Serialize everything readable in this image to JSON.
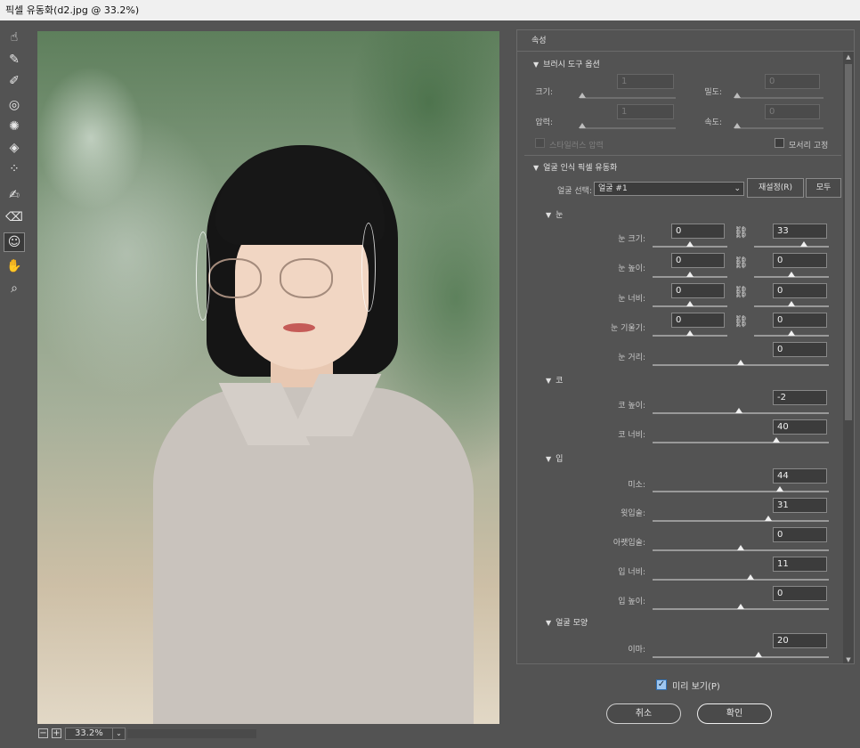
{
  "window": {
    "title": "픽셀 유동화(d2.jpg @ 33.2%)"
  },
  "toolbar": {
    "tools": [
      {
        "name": "forward-warp-tool",
        "glyph": "☝"
      },
      {
        "name": "reconstruct-tool",
        "glyph": "✎"
      },
      {
        "name": "smooth-tool",
        "glyph": "✐"
      },
      {
        "name": "twirl-tool",
        "glyph": "◎"
      },
      {
        "name": "pucker-tool",
        "glyph": "✺"
      },
      {
        "name": "bloat-tool",
        "glyph": "◈"
      },
      {
        "name": "push-left-tool",
        "glyph": "⁘"
      },
      {
        "name": "freeze-mask-tool",
        "glyph": "✍"
      },
      {
        "name": "thaw-mask-tool",
        "glyph": "⌫"
      },
      {
        "name": "face-tool",
        "glyph": "☺"
      },
      {
        "name": "hand-tool",
        "glyph": "✋"
      },
      {
        "name": "zoom-tool",
        "glyph": "⌕"
      }
    ]
  },
  "zoom": {
    "minus": "−",
    "plus": "+",
    "value": "33.2%",
    "chevron": "⌄"
  },
  "properties": {
    "header": "속성",
    "brush_section": "브러시 도구 옵션",
    "brush": {
      "size_label": "크기:",
      "size_value": "1",
      "density_label": "밀도:",
      "density_value": "0",
      "pressure_label": "압력:",
      "pressure_value": "1",
      "rate_label": "속도:",
      "rate_value": "0",
      "stylus_label": "스타일러스 압력",
      "pin_edges_label": "모서리 고정"
    },
    "face_section": "얼굴 인식 픽셀 유동화",
    "face_select_label": "얼굴 선택:",
    "face_select_value": "얼굴 #1",
    "reset_button": "재설정(R)",
    "all_button": "모두",
    "eyes_section": "눈",
    "eyes": {
      "size_label": "눈 크기:",
      "size_l": "0",
      "size_r": "33",
      "height_label": "눈 높이:",
      "height_l": "0",
      "height_r": "0",
      "width_label": "눈 너비:",
      "width_l": "0",
      "width_r": "0",
      "tilt_label": "눈 기울기:",
      "tilt_l": "0",
      "tilt_r": "0",
      "distance_label": "눈 거리:",
      "distance_value": "0"
    },
    "nose_section": "코",
    "nose": {
      "height_label": "코 높이:",
      "height_value": "-2",
      "width_label": "코 너비:",
      "width_value": "40"
    },
    "mouth_section": "입",
    "mouth": {
      "smile_label": "미소:",
      "smile_value": "44",
      "upper_lip_label": "윗입술:",
      "upper_lip_value": "31",
      "lower_lip_label": "아랫입술:",
      "lower_lip_value": "0",
      "width_label": "입 너비:",
      "width_value": "11",
      "height_label": "입 높이:",
      "height_value": "0"
    },
    "face_shape_section": "얼굴 모양",
    "face_shape": {
      "forehead_label": "이마:",
      "forehead_value": "20"
    }
  },
  "footer": {
    "preview_label": "미리 보기(P)",
    "preview_checked": true,
    "cancel_button": "취소",
    "ok_button": "확인"
  }
}
